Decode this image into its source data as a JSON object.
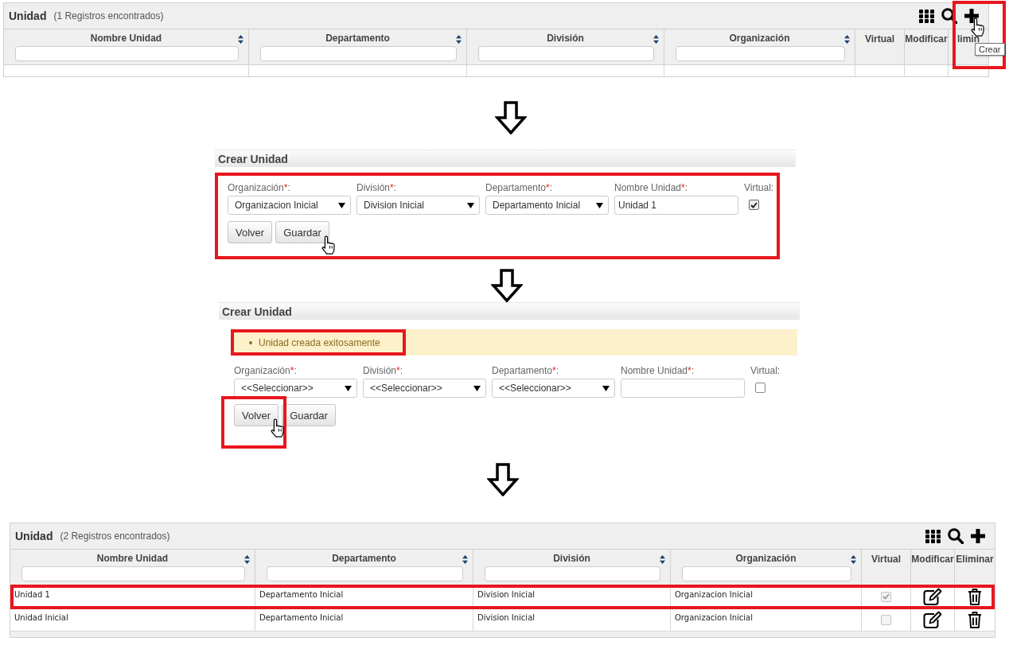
{
  "steps": [
    {
      "kind": "list",
      "title": "Unidad",
      "count": "(1 Registros encontrados)",
      "toolbar": [
        {
          "kind": "grid",
          "highlighted": false,
          "hovered": false
        },
        {
          "kind": "search",
          "highlighted": false,
          "hovered": false
        },
        {
          "kind": "add",
          "highlighted": true,
          "hovered": true,
          "tooltip": "Crear"
        }
      ],
      "columns": [
        {
          "label": "Nombre Unidad",
          "sortable": true,
          "filterable": true
        },
        {
          "label": "Departamento",
          "sortable": true,
          "filterable": true
        },
        {
          "label": "División",
          "sortable": true,
          "filterable": true
        },
        {
          "label": "Organización",
          "sortable": true,
          "filterable": true
        },
        {
          "label": "Virtual",
          "sortable": false,
          "filterable": false
        },
        {
          "label": "Modificar",
          "sortable": false,
          "filterable": false
        },
        {
          "label": "limin",
          "sortable": false,
          "filterable": false
        }
      ]
    },
    {
      "kind": "form",
      "title": "Crear Unidad",
      "highlighted": true,
      "fields": [
        {
          "kind": "select",
          "label": "Organización",
          "required_mark": "*",
          "label_suffix": ":",
          "value": "Organizacion Inicial"
        },
        {
          "kind": "select",
          "label": "División",
          "required_mark": "*",
          "label_suffix": ":",
          "value": "Division Inicial"
        },
        {
          "kind": "select",
          "label": "Departamento",
          "required_mark": "*",
          "label_suffix": ":",
          "value": "Departamento Inicial"
        },
        {
          "kind": "text",
          "label": "Nombre Unidad",
          "required_mark": "*",
          "label_suffix": ":",
          "value": "Unidad 1"
        },
        {
          "kind": "checkbox",
          "label": "Virtual",
          "label_suffix": ":",
          "checked": true
        }
      ],
      "buttons": [
        {
          "label": "Volver",
          "highlighted": false,
          "hovered": false
        },
        {
          "label": "Guardar",
          "highlighted": false,
          "hovered": true
        }
      ]
    },
    {
      "kind": "form",
      "title": "Crear Unidad",
      "highlighted": false,
      "message": {
        "text": "Unidad creada exitosamente",
        "highlighted": true
      },
      "fields": [
        {
          "kind": "select",
          "label": "Organización",
          "required_mark": "*",
          "label_suffix": ":",
          "value": "<<Seleccionar>>"
        },
        {
          "kind": "select",
          "label": "División",
          "required_mark": "*",
          "label_suffix": ":",
          "value": "<<Seleccionar>>"
        },
        {
          "kind": "select",
          "label": "Departamento",
          "required_mark": "*",
          "label_suffix": ":",
          "value": "<<Seleccionar>>"
        },
        {
          "kind": "text",
          "label": "Nombre Unidad",
          "required_mark": "*",
          "label_suffix": ":"
        },
        {
          "kind": "checkbox",
          "label": "Virtual",
          "label_suffix": ":",
          "checked": false
        }
      ],
      "buttons": [
        {
          "label": "Volver",
          "highlighted": true,
          "hovered": true
        },
        {
          "label": "Guardar",
          "highlighted": false,
          "hovered": false
        }
      ]
    },
    {
      "kind": "list",
      "title": "Unidad",
      "count": "(2 Registros encontrados)",
      "toolbar": [
        {
          "kind": "grid",
          "highlighted": false,
          "hovered": false
        },
        {
          "kind": "search",
          "highlighted": false,
          "hovered": false
        },
        {
          "kind": "add",
          "highlighted": false,
          "hovered": false
        }
      ],
      "columns": [
        {
          "label": "Nombre Unidad",
          "sortable": true,
          "filterable": true
        },
        {
          "label": "Departamento",
          "sortable": true,
          "filterable": true
        },
        {
          "label": "División",
          "sortable": true,
          "filterable": true
        },
        {
          "label": "Organización",
          "sortable": true,
          "filterable": true
        },
        {
          "label": "Virtual",
          "sortable": false,
          "filterable": false
        },
        {
          "label": "Modificar",
          "sortable": false,
          "filterable": false
        },
        {
          "label": "Eliminar",
          "sortable": false,
          "filterable": false
        }
      ],
      "rows": [
        {
          "cells": [
            "Unidad 1",
            "Departamento Inicial",
            "Division Inicial",
            "Organizacion Inicial"
          ],
          "virtual": true,
          "highlighted": true
        },
        {
          "cells": [
            "Unidad Inicial",
            "Departamento Inicial",
            "Division Inicial",
            "Organizacion Inicial"
          ],
          "virtual": false,
          "highlighted": false
        }
      ]
    }
  ]
}
